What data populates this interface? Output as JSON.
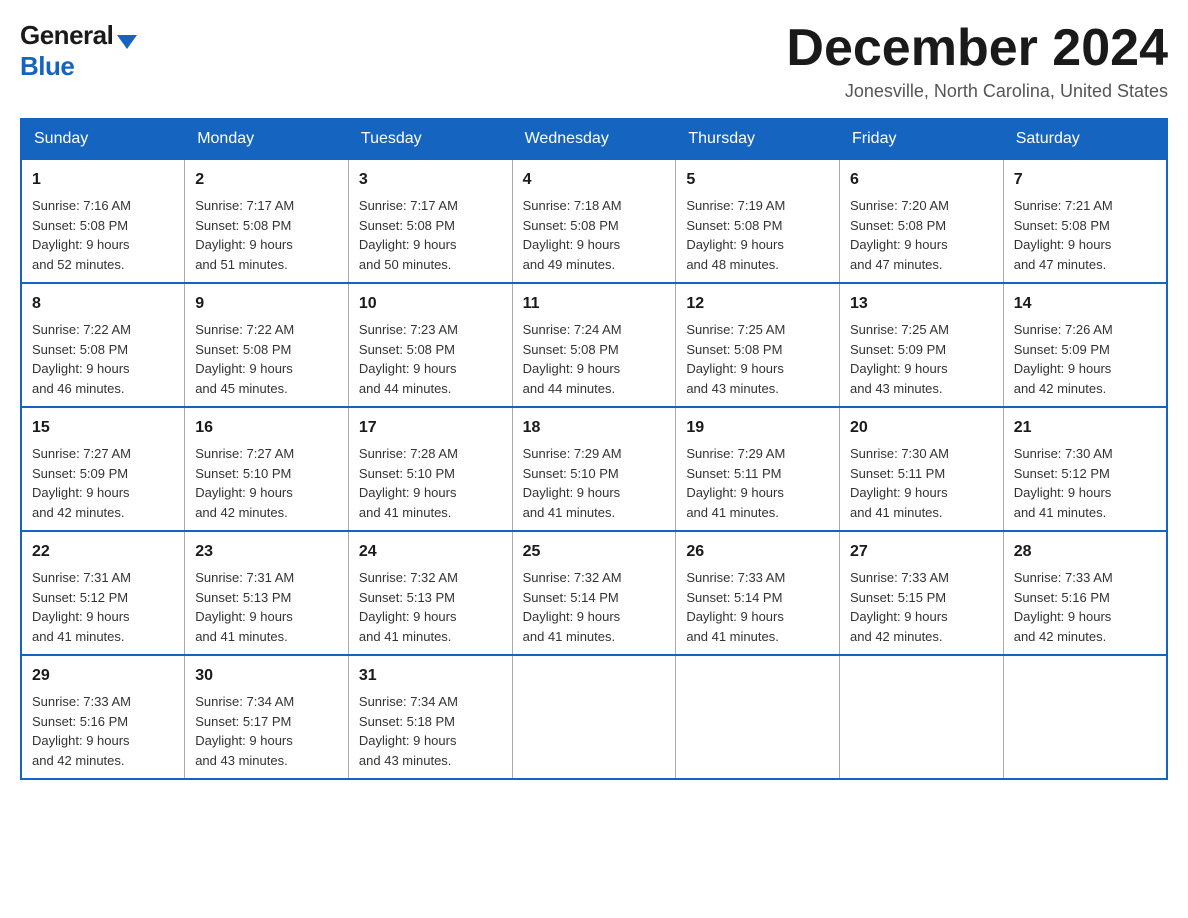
{
  "logo": {
    "general": "General",
    "blue": "Blue"
  },
  "title": "December 2024",
  "subtitle": "Jonesville, North Carolina, United States",
  "headers": [
    "Sunday",
    "Monday",
    "Tuesday",
    "Wednesday",
    "Thursday",
    "Friday",
    "Saturday"
  ],
  "weeks": [
    [
      {
        "day": "1",
        "sunrise": "Sunrise: 7:16 AM",
        "sunset": "Sunset: 5:08 PM",
        "daylight": "Daylight: 9 hours",
        "daylight2": "and 52 minutes."
      },
      {
        "day": "2",
        "sunrise": "Sunrise: 7:17 AM",
        "sunset": "Sunset: 5:08 PM",
        "daylight": "Daylight: 9 hours",
        "daylight2": "and 51 minutes."
      },
      {
        "day": "3",
        "sunrise": "Sunrise: 7:17 AM",
        "sunset": "Sunset: 5:08 PM",
        "daylight": "Daylight: 9 hours",
        "daylight2": "and 50 minutes."
      },
      {
        "day": "4",
        "sunrise": "Sunrise: 7:18 AM",
        "sunset": "Sunset: 5:08 PM",
        "daylight": "Daylight: 9 hours",
        "daylight2": "and 49 minutes."
      },
      {
        "day": "5",
        "sunrise": "Sunrise: 7:19 AM",
        "sunset": "Sunset: 5:08 PM",
        "daylight": "Daylight: 9 hours",
        "daylight2": "and 48 minutes."
      },
      {
        "day": "6",
        "sunrise": "Sunrise: 7:20 AM",
        "sunset": "Sunset: 5:08 PM",
        "daylight": "Daylight: 9 hours",
        "daylight2": "and 47 minutes."
      },
      {
        "day": "7",
        "sunrise": "Sunrise: 7:21 AM",
        "sunset": "Sunset: 5:08 PM",
        "daylight": "Daylight: 9 hours",
        "daylight2": "and 47 minutes."
      }
    ],
    [
      {
        "day": "8",
        "sunrise": "Sunrise: 7:22 AM",
        "sunset": "Sunset: 5:08 PM",
        "daylight": "Daylight: 9 hours",
        "daylight2": "and 46 minutes."
      },
      {
        "day": "9",
        "sunrise": "Sunrise: 7:22 AM",
        "sunset": "Sunset: 5:08 PM",
        "daylight": "Daylight: 9 hours",
        "daylight2": "and 45 minutes."
      },
      {
        "day": "10",
        "sunrise": "Sunrise: 7:23 AM",
        "sunset": "Sunset: 5:08 PM",
        "daylight": "Daylight: 9 hours",
        "daylight2": "and 44 minutes."
      },
      {
        "day": "11",
        "sunrise": "Sunrise: 7:24 AM",
        "sunset": "Sunset: 5:08 PM",
        "daylight": "Daylight: 9 hours",
        "daylight2": "and 44 minutes."
      },
      {
        "day": "12",
        "sunrise": "Sunrise: 7:25 AM",
        "sunset": "Sunset: 5:08 PM",
        "daylight": "Daylight: 9 hours",
        "daylight2": "and 43 minutes."
      },
      {
        "day": "13",
        "sunrise": "Sunrise: 7:25 AM",
        "sunset": "Sunset: 5:09 PM",
        "daylight": "Daylight: 9 hours",
        "daylight2": "and 43 minutes."
      },
      {
        "day": "14",
        "sunrise": "Sunrise: 7:26 AM",
        "sunset": "Sunset: 5:09 PM",
        "daylight": "Daylight: 9 hours",
        "daylight2": "and 42 minutes."
      }
    ],
    [
      {
        "day": "15",
        "sunrise": "Sunrise: 7:27 AM",
        "sunset": "Sunset: 5:09 PM",
        "daylight": "Daylight: 9 hours",
        "daylight2": "and 42 minutes."
      },
      {
        "day": "16",
        "sunrise": "Sunrise: 7:27 AM",
        "sunset": "Sunset: 5:10 PM",
        "daylight": "Daylight: 9 hours",
        "daylight2": "and 42 minutes."
      },
      {
        "day": "17",
        "sunrise": "Sunrise: 7:28 AM",
        "sunset": "Sunset: 5:10 PM",
        "daylight": "Daylight: 9 hours",
        "daylight2": "and 41 minutes."
      },
      {
        "day": "18",
        "sunrise": "Sunrise: 7:29 AM",
        "sunset": "Sunset: 5:10 PM",
        "daylight": "Daylight: 9 hours",
        "daylight2": "and 41 minutes."
      },
      {
        "day": "19",
        "sunrise": "Sunrise: 7:29 AM",
        "sunset": "Sunset: 5:11 PM",
        "daylight": "Daylight: 9 hours",
        "daylight2": "and 41 minutes."
      },
      {
        "day": "20",
        "sunrise": "Sunrise: 7:30 AM",
        "sunset": "Sunset: 5:11 PM",
        "daylight": "Daylight: 9 hours",
        "daylight2": "and 41 minutes."
      },
      {
        "day": "21",
        "sunrise": "Sunrise: 7:30 AM",
        "sunset": "Sunset: 5:12 PM",
        "daylight": "Daylight: 9 hours",
        "daylight2": "and 41 minutes."
      }
    ],
    [
      {
        "day": "22",
        "sunrise": "Sunrise: 7:31 AM",
        "sunset": "Sunset: 5:12 PM",
        "daylight": "Daylight: 9 hours",
        "daylight2": "and 41 minutes."
      },
      {
        "day": "23",
        "sunrise": "Sunrise: 7:31 AM",
        "sunset": "Sunset: 5:13 PM",
        "daylight": "Daylight: 9 hours",
        "daylight2": "and 41 minutes."
      },
      {
        "day": "24",
        "sunrise": "Sunrise: 7:32 AM",
        "sunset": "Sunset: 5:13 PM",
        "daylight": "Daylight: 9 hours",
        "daylight2": "and 41 minutes."
      },
      {
        "day": "25",
        "sunrise": "Sunrise: 7:32 AM",
        "sunset": "Sunset: 5:14 PM",
        "daylight": "Daylight: 9 hours",
        "daylight2": "and 41 minutes."
      },
      {
        "day": "26",
        "sunrise": "Sunrise: 7:33 AM",
        "sunset": "Sunset: 5:14 PM",
        "daylight": "Daylight: 9 hours",
        "daylight2": "and 41 minutes."
      },
      {
        "day": "27",
        "sunrise": "Sunrise: 7:33 AM",
        "sunset": "Sunset: 5:15 PM",
        "daylight": "Daylight: 9 hours",
        "daylight2": "and 42 minutes."
      },
      {
        "day": "28",
        "sunrise": "Sunrise: 7:33 AM",
        "sunset": "Sunset: 5:16 PM",
        "daylight": "Daylight: 9 hours",
        "daylight2": "and 42 minutes."
      }
    ],
    [
      {
        "day": "29",
        "sunrise": "Sunrise: 7:33 AM",
        "sunset": "Sunset: 5:16 PM",
        "daylight": "Daylight: 9 hours",
        "daylight2": "and 42 minutes."
      },
      {
        "day": "30",
        "sunrise": "Sunrise: 7:34 AM",
        "sunset": "Sunset: 5:17 PM",
        "daylight": "Daylight: 9 hours",
        "daylight2": "and 43 minutes."
      },
      {
        "day": "31",
        "sunrise": "Sunrise: 7:34 AM",
        "sunset": "Sunset: 5:18 PM",
        "daylight": "Daylight: 9 hours",
        "daylight2": "and 43 minutes."
      },
      null,
      null,
      null,
      null
    ]
  ]
}
